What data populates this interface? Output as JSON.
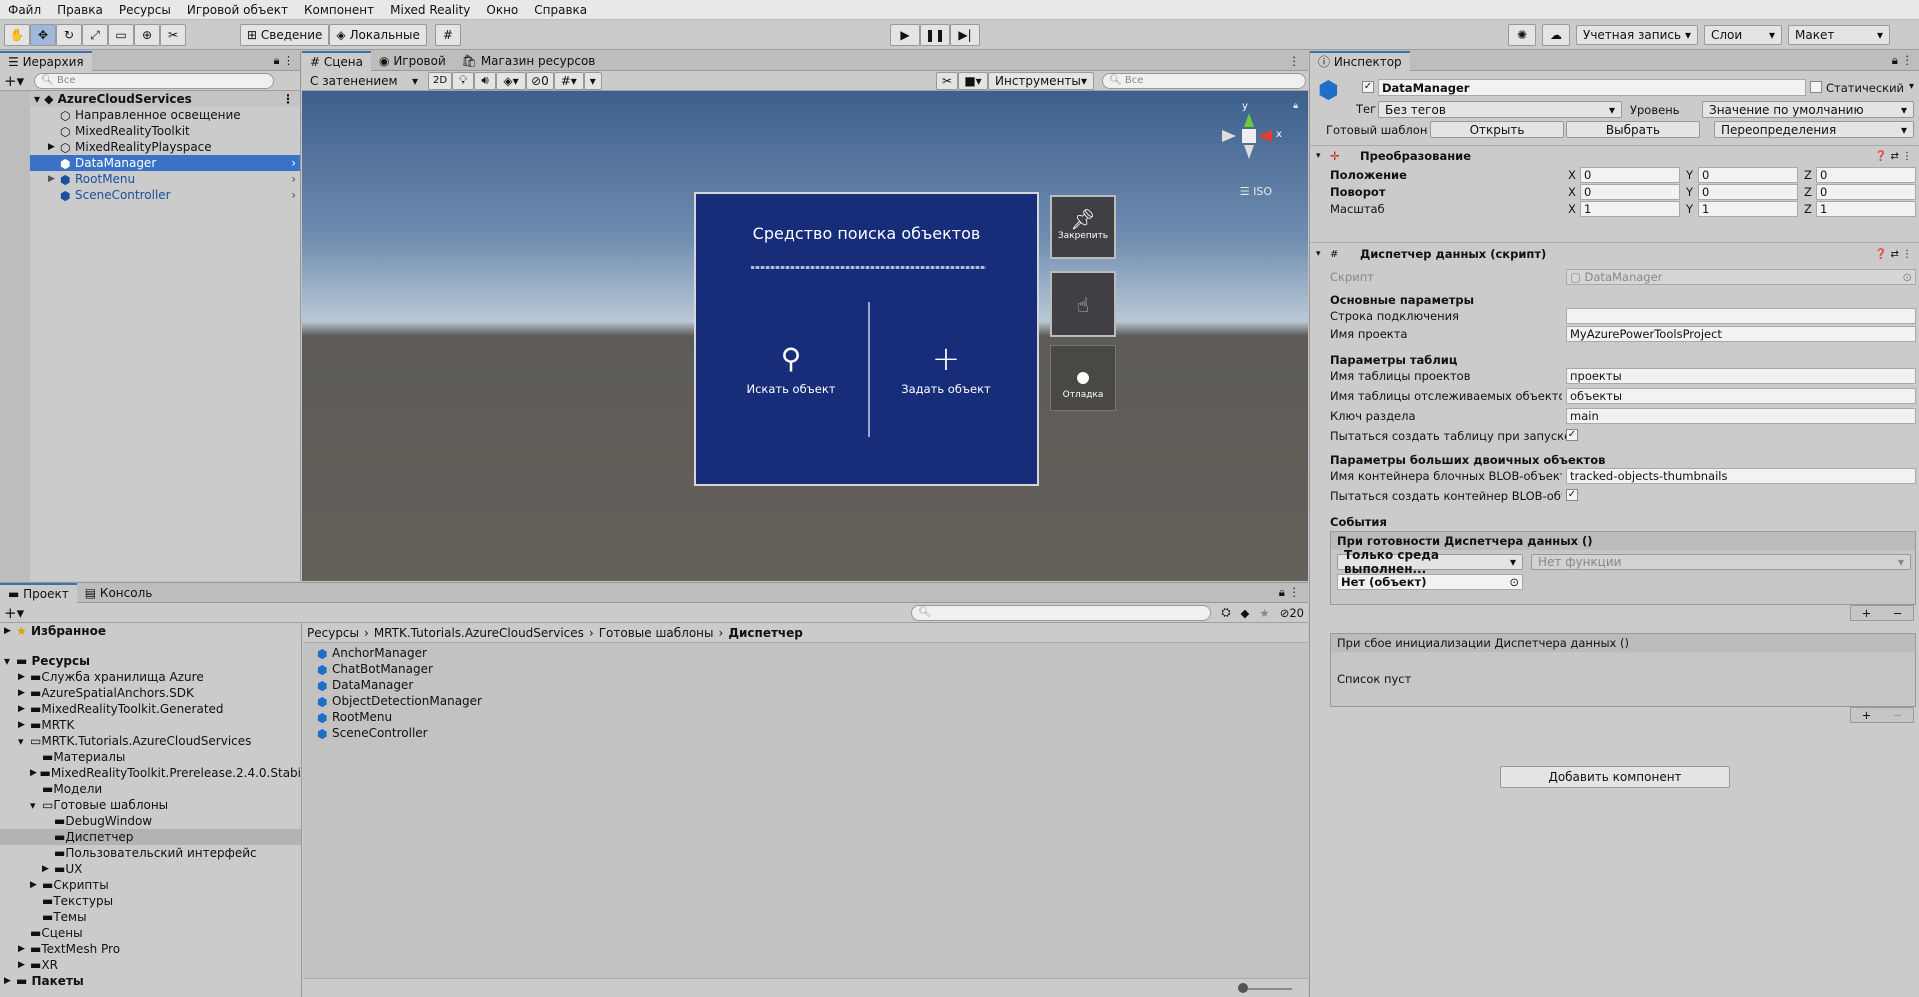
{
  "menu": [
    "Файл",
    "Правка",
    "Ресурсы",
    "Игровой объект",
    "Компонент",
    "Mixed Reality",
    "Окно",
    "Справка"
  ],
  "toolbar": {
    "pivot": "Сведение",
    "local": "Локальные",
    "account": "Учетная запись",
    "layers": "Слои",
    "layout": "Макет"
  },
  "hierarchy": {
    "tab": "Иерархия",
    "search_placeholder": "Все",
    "scene": "AzureCloudServices",
    "items": [
      "Направленное освещение",
      "MixedRealityToolkit",
      "MixedRealityPlayspace",
      "DataManager",
      "RootMenu",
      "SceneController"
    ]
  },
  "scene": {
    "tabs": [
      "Сцена",
      "Игровой",
      "Магазин ресурсов"
    ],
    "shading": "С затенением",
    "mode2d": "2D",
    "hidden_count": "0",
    "tools": "Инструменты",
    "search_placeholder": "Все",
    "iso": "ISO",
    "axis_y": "y",
    "axis_x": "x",
    "panel_title": "Средство поиска объектов",
    "search_btn": "Искать объект",
    "set_btn": "Задать объект",
    "pin_label": "Закрепить",
    "debug_label": "Отладка"
  },
  "inspector": {
    "tab": "Инспектор",
    "object_name": "DataManager",
    "static_label": "Статический",
    "tag_label": "Тег",
    "tag_value": "Без тегов",
    "layer_label": "Уровень",
    "layer_value": "Значение по умолчанию",
    "prefab_label": "Готовый шаблон",
    "open": "Открыть",
    "select": "Выбрать",
    "overrides": "Переопределения",
    "transform_title": "Преобразование",
    "position": "Положение",
    "rotation": "Поворот",
    "scale": "Масштаб",
    "pos": [
      "0",
      "0",
      "0"
    ],
    "rot": [
      "0",
      "0",
      "0"
    ],
    "scl": [
      "1",
      "1",
      "1"
    ],
    "axes": [
      "X",
      "Y",
      "Z"
    ],
    "script_comp": "Диспетчер данных (скрипт)",
    "script_label": "Скрипт",
    "script_value": "DataManager",
    "basic_params": "Основные параметры",
    "conn_string": "Строка подключения",
    "conn_value": "",
    "project_name": "Имя проекта",
    "project_value": "MyAzurePowerToolsProject",
    "table_params": "Параметры таблиц",
    "projects_table": "Имя таблицы проектов",
    "projects_value": "проекты",
    "tracked_table": "Имя таблицы отслеживаемых объектов",
    "tracked_value": "объекты",
    "partition_key": "Ключ раздела",
    "partition_value": "main",
    "try_create_table": "Пытаться создать таблицу при запуске",
    "blob_params": "Параметры больших двоичных объектов",
    "blob_container": "Имя контейнера блочных BLOB-объектов",
    "blob_value": "tracked-objects-thumbnails",
    "try_create_blob": "Пытаться создать контейнер BLOB-объ...",
    "events": "События",
    "on_ready": "При готовности Диспетчера данных ()",
    "runtime_only": "Только среда выполнен...",
    "no_function": "Нет функции",
    "none_object": "Нет (объект)",
    "on_fail": "При сбое инициализации Диспетчера данных ()",
    "list_empty": "Список пуст",
    "add_component": "Добавить компонент"
  },
  "project": {
    "tabs": [
      "Проект",
      "Консоль"
    ],
    "hidden_count": "20",
    "favorites": "Избранное",
    "assets": "Ресурсы",
    "packages": "Пакеты",
    "tree": [
      {
        "label": "Служба хранилища Azure",
        "indent": 1
      },
      {
        "label": "AzureSpatialAnchors.SDK",
        "indent": 1
      },
      {
        "label": "MixedRealityToolkit.Generated",
        "indent": 1
      },
      {
        "label": "MRTK",
        "indent": 1
      },
      {
        "label": "MRTK.Tutorials.AzureCloudServices",
        "indent": 1
      },
      {
        "label": "Материалы",
        "indent": 2
      },
      {
        "label": "MixedRealityToolkit.Prerelease.2.4.0.Stabi",
        "indent": 2
      },
      {
        "label": "Модели",
        "indent": 2
      },
      {
        "label": "Готовые шаблоны",
        "indent": 2
      },
      {
        "label": "DebugWindow",
        "indent": 3
      },
      {
        "label": "Диспетчер",
        "indent": 3
      },
      {
        "label": "Пользовательский интерфейс",
        "indent": 3
      },
      {
        "label": "UX",
        "indent": 3
      },
      {
        "label": "Скрипты",
        "indent": 2
      },
      {
        "label": "Текстуры",
        "indent": 2
      },
      {
        "label": "Темы",
        "indent": 2
      },
      {
        "label": "Сцены",
        "indent": 1
      },
      {
        "label": "TextMesh Pro",
        "indent": 1
      },
      {
        "label": "XR",
        "indent": 1
      }
    ],
    "breadcrumb": [
      "Ресурсы",
      "MRTK.Tutorials.AzureCloudServices",
      "Готовые шаблоны",
      "Диспетчер"
    ],
    "files": [
      "AnchorManager",
      "ChatBotManager",
      "DataManager",
      "ObjectDetectionManager",
      "RootMenu",
      "SceneController"
    ]
  }
}
